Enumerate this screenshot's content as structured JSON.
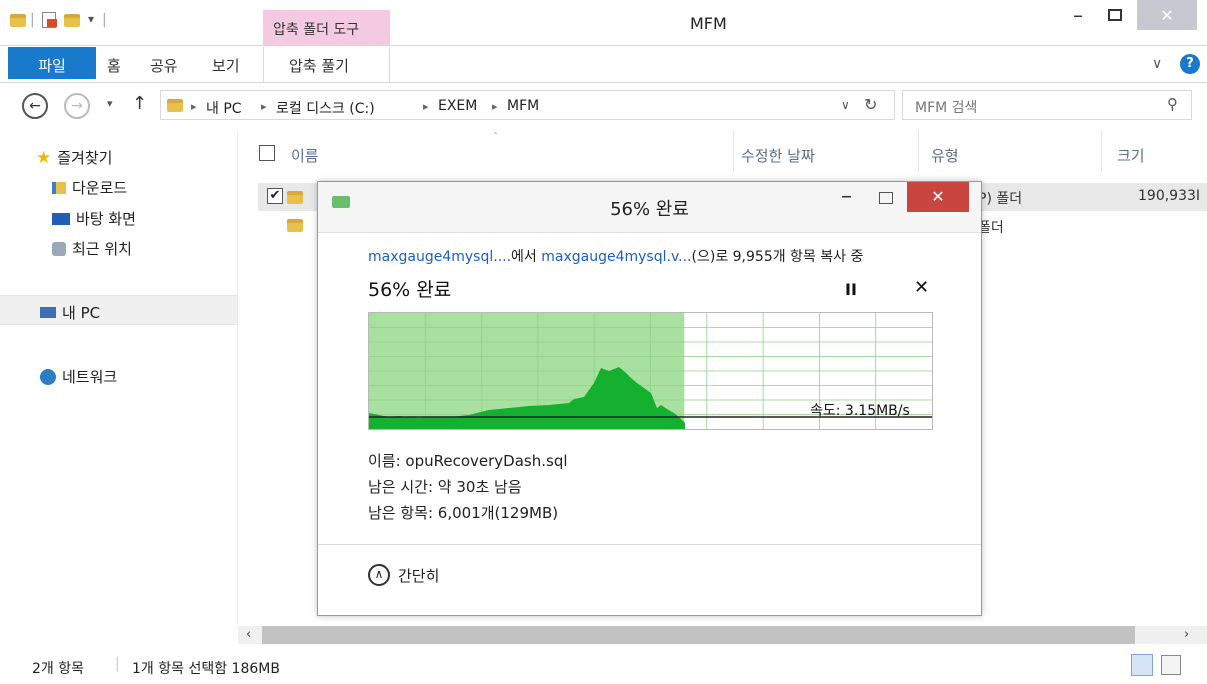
{
  "titlebar": {
    "context_tab": "압축 폴더 도구",
    "window_title": "MFM",
    "minimize": "–",
    "close": "✕"
  },
  "ribbon": {
    "file": "파일",
    "home": "홈",
    "share": "공유",
    "view": "보기",
    "extract": "압축 풀기",
    "help": "?"
  },
  "address": {
    "crumbs": [
      "내 PC",
      "로컬 디스크 (C:)",
      "EXEM",
      "MFM"
    ],
    "search_placeholder": "MFM 검색"
  },
  "nav": {
    "favorites": "즐겨찾기",
    "downloads": "다운로드",
    "desktop": "바탕 화면",
    "recent": "최근 위치",
    "this_pc": "내 PC",
    "network": "네트워크"
  },
  "columns": {
    "name": "이름",
    "date": "수정한 날짜",
    "type": "유형",
    "size": "크기"
  },
  "rows": [
    {
      "type": "P) 폴더",
      "size": "190,933I"
    },
    {
      "type": "폴더"
    }
  ],
  "status": {
    "items": "2개 항목",
    "selected": "1개 항목 선택함 186MB"
  },
  "dialog": {
    "title": "56% 완료",
    "source": "maxgauge4mysql....",
    "from_text": "에서 ",
    "dest": "maxgauge4mysql.v...",
    "copy_text": "(으)로 9,955개 항목 복사 중",
    "percent_label": "56% 완료",
    "pause": "II",
    "cancel": "✕",
    "speed": "속도: 3.15MB/s",
    "name_line": "이름: opuRecoveryDash.sql",
    "time_line": "남은 시간: 약 30초 남음",
    "items_line": "남은 항목: 6,001개(129MB)",
    "less_details": "간단히",
    "progress": 0.56
  },
  "colors": {
    "accent": "#1979ca",
    "context_tab": "#f4c9e2",
    "progress_fill": "#a8e0a0",
    "graph_area": "#16b030",
    "close_red": "#c9453f"
  }
}
